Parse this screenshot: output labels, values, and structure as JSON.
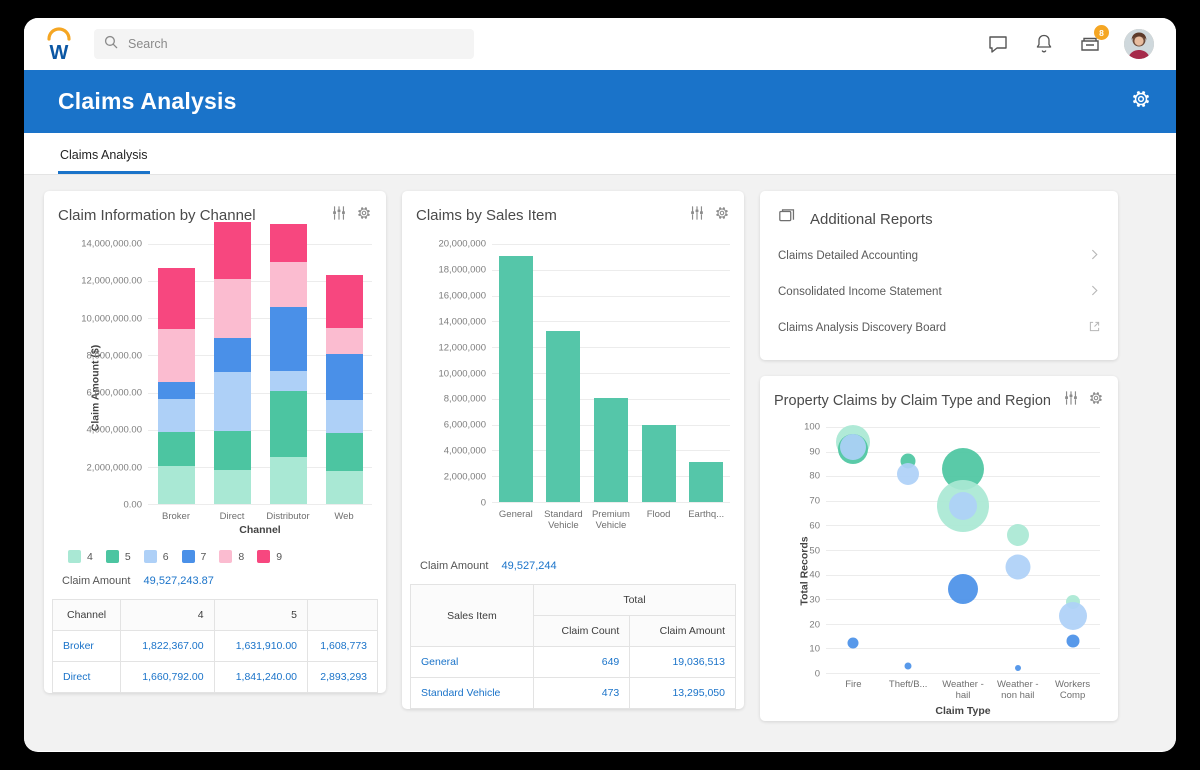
{
  "topbar": {
    "logo_name": "workday-logo",
    "search": {
      "placeholder": "Search",
      "value": ""
    },
    "icons": [
      {
        "name": "chat-icon",
        "label": "Chat"
      },
      {
        "name": "notifications-icon",
        "label": "Notifications"
      },
      {
        "name": "inbox-icon",
        "label": "Inbox",
        "badge": "8"
      }
    ],
    "avatar_label": "User Profile"
  },
  "header": {
    "title": "Claims Analysis",
    "gear_label": "Settings"
  },
  "tabs": [
    {
      "label": "Claims Analysis",
      "active": true
    }
  ],
  "cards": {
    "claim_info": {
      "title": "Claim Information by Channel",
      "filter_icon": "filter-icon",
      "gear_icon": "gear-icon",
      "total_label": "Claim Amount",
      "total_value": "49,527,243.87",
      "table": {
        "headers": [
          "Channel",
          "4",
          "5",
          ""
        ],
        "rows": [
          [
            "Broker",
            "1,822,367.00",
            "1,631,910.00",
            "1,608,773"
          ],
          [
            "Direct",
            "1,660,792.00",
            "1,841,240.00",
            "2,893,293"
          ]
        ]
      }
    },
    "claims_sales": {
      "title": "Claims by Sales Item",
      "filter_icon": "filter-icon",
      "gear_icon": "gear-icon",
      "total_label": "Claim Amount",
      "total_value": "49,527,244",
      "table": {
        "group_header": "Total",
        "headers": [
          "Sales Item",
          "Claim Count",
          "Claim Amount"
        ],
        "rows": [
          [
            "General",
            "649",
            "19,036,513"
          ],
          [
            "Standard Vehicle",
            "473",
            "13,295,050"
          ]
        ]
      }
    },
    "additional_reports": {
      "title": "Additional Reports",
      "panel_icon": "reports-icon",
      "items": [
        {
          "label": "Claims Detailed Accounting",
          "icon": "chevron-right-icon"
        },
        {
          "label": "Consolidated Income Statement",
          "icon": "chevron-right-icon"
        },
        {
          "label": "Claims Analysis Discovery Board",
          "icon": "external-link-icon"
        }
      ]
    },
    "property_claims": {
      "title": "Property Claims by Claim Type and Region",
      "filter_icon": "filter-icon",
      "gear_icon": "gear-icon"
    }
  },
  "colors": {
    "brand_blue": "#1a73c9",
    "logo_orange": "#f5a623",
    "link_blue": "#1a73c9",
    "teal": "#55c6a9",
    "series": [
      "#a9e8d4",
      "#4cc5a1",
      "#aed0f7",
      "#4a90e8",
      "#fbbcd0",
      "#f7477f"
    ]
  },
  "chart_data": [
    {
      "type": "bar",
      "stacked": true,
      "title": "Claim Information by Channel",
      "xlabel": "Channel",
      "ylabel": "Claim Amount ($)",
      "categories": [
        "Broker",
        "Direct",
        "Distributor",
        "Web"
      ],
      "ylim": [
        0,
        14000000
      ],
      "yticks": [
        "0.00",
        "2,000,000.00",
        "4,000,000.00",
        "6,000,000.00",
        "8,000,000.00",
        "10,000,000.00",
        "12,000,000.00",
        "14,000,000.00"
      ],
      "grid": true,
      "legend_position": "bottom",
      "series": [
        {
          "name": "4",
          "color": "#a9e8d4",
          "values": [
            1822367,
            1660792,
            2250000,
            1590000
          ]
        },
        {
          "name": "5",
          "color": "#4cc5a1",
          "values": [
            1631910,
            1841240,
            3200000,
            1830000
          ]
        },
        {
          "name": "6",
          "color": "#aed0f7",
          "values": [
            1608773,
            2893293,
            950000,
            1600000
          ]
        },
        {
          "name": "7",
          "color": "#4a90e8",
          "values": [
            850000,
            1600000,
            3100000,
            2200000
          ]
        },
        {
          "name": "8",
          "color": "#fbbcd0",
          "values": [
            2550000,
            2850000,
            2200000,
            1300000
          ]
        },
        {
          "name": "9",
          "color": "#f7477f",
          "values": [
            2950000,
            2750000,
            1800000,
            2530000
          ]
        }
      ],
      "total_label": "Claim Amount",
      "total_value": "49,527,243.87"
    },
    {
      "type": "bar",
      "title": "Claims by Sales Item",
      "xlabel": "",
      "ylabel": "",
      "categories": [
        "General",
        "Standard Vehicle",
        "Premium Vehicle",
        "Flood",
        "Earthq..."
      ],
      "values": [
        19036513,
        13295050,
        8100000,
        6000000,
        3100000
      ],
      "ylim": [
        0,
        20000000
      ],
      "yticks": [
        "0",
        "2,000,000",
        "4,000,000",
        "6,000,000",
        "8,000,000",
        "10,000,000",
        "12,000,000",
        "14,000,000",
        "16,000,000",
        "18,000,000",
        "20,000,000"
      ],
      "color": "#55c6a9",
      "grid": true,
      "total_label": "Claim Amount",
      "total_value": "49,527,244"
    },
    {
      "type": "scatter",
      "bubble": true,
      "title": "Property Claims by Claim Type and Region",
      "xlabel": "Claim Type",
      "ylabel": "Total Records",
      "categories": [
        "Fire",
        "Theft/B...",
        "Weather - hail",
        "Weather - non hail",
        "Workers Comp"
      ],
      "ylim": [
        0,
        100
      ],
      "yticks": [
        "0",
        "10",
        "20",
        "30",
        "40",
        "50",
        "60",
        "70",
        "80",
        "90",
        "100"
      ],
      "grid": true,
      "points": [
        {
          "x": 0,
          "y": 94,
          "size": 34,
          "color": "#a9e8d4"
        },
        {
          "x": 0,
          "y": 91,
          "size": 30,
          "color": "#4cc5a1"
        },
        {
          "x": 0,
          "y": 92,
          "size": 26,
          "color": "#aed0f7"
        },
        {
          "x": 0,
          "y": 12,
          "size": 11,
          "color": "#4a90e8"
        },
        {
          "x": 1,
          "y": 86,
          "size": 15,
          "color": "#4cc5a1"
        },
        {
          "x": 1,
          "y": 81,
          "size": 22,
          "color": "#aed0f7"
        },
        {
          "x": 1,
          "y": 3,
          "size": 7,
          "color": "#4a90e8"
        },
        {
          "x": 2,
          "y": 83,
          "size": 42,
          "color": "#4cc5a1"
        },
        {
          "x": 2,
          "y": 68,
          "size": 52,
          "color": "#a9e8d4"
        },
        {
          "x": 2,
          "y": 68,
          "size": 28,
          "color": "#aed0f7"
        },
        {
          "x": 2,
          "y": 34,
          "size": 30,
          "color": "#4a90e8"
        },
        {
          "x": 3,
          "y": 56,
          "size": 22,
          "color": "#a9e8d4"
        },
        {
          "x": 3,
          "y": 43,
          "size": 25,
          "color": "#aed0f7"
        },
        {
          "x": 3,
          "y": 2,
          "size": 6,
          "color": "#4a90e8"
        },
        {
          "x": 4,
          "y": 29,
          "size": 14,
          "color": "#a9e8d4"
        },
        {
          "x": 4,
          "y": 23,
          "size": 28,
          "color": "#aed0f7"
        },
        {
          "x": 4,
          "y": 13,
          "size": 13,
          "color": "#4a90e8"
        }
      ]
    }
  ]
}
